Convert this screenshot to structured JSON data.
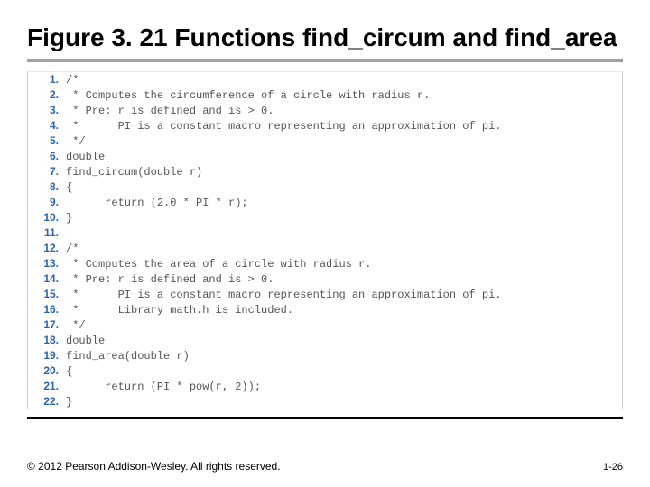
{
  "title": "Figure 3. 21  Functions find_circum and find_area",
  "code": [
    "/*",
    " * Computes the circumference of a circle with radius r.",
    " * Pre: r is defined and is > 0.",
    " *      PI is a constant macro representing an approximation of pi.",
    " */",
    "double",
    "find_circum(double r)",
    "{",
    "      return (2.0 * PI * r);",
    "}",
    "",
    "/*",
    " * Computes the area of a circle with radius r.",
    " * Pre: r is defined and is > 0.",
    " *      PI is a constant macro representing an approximation of pi.",
    " *      Library math.h is included.",
    " */",
    "double",
    "find_area(double r)",
    "{",
    "      return (PI * pow(r, 2));",
    "}"
  ],
  "copyright": "© 2012 Pearson Addison-Wesley. All rights reserved.",
  "page": "1-26"
}
